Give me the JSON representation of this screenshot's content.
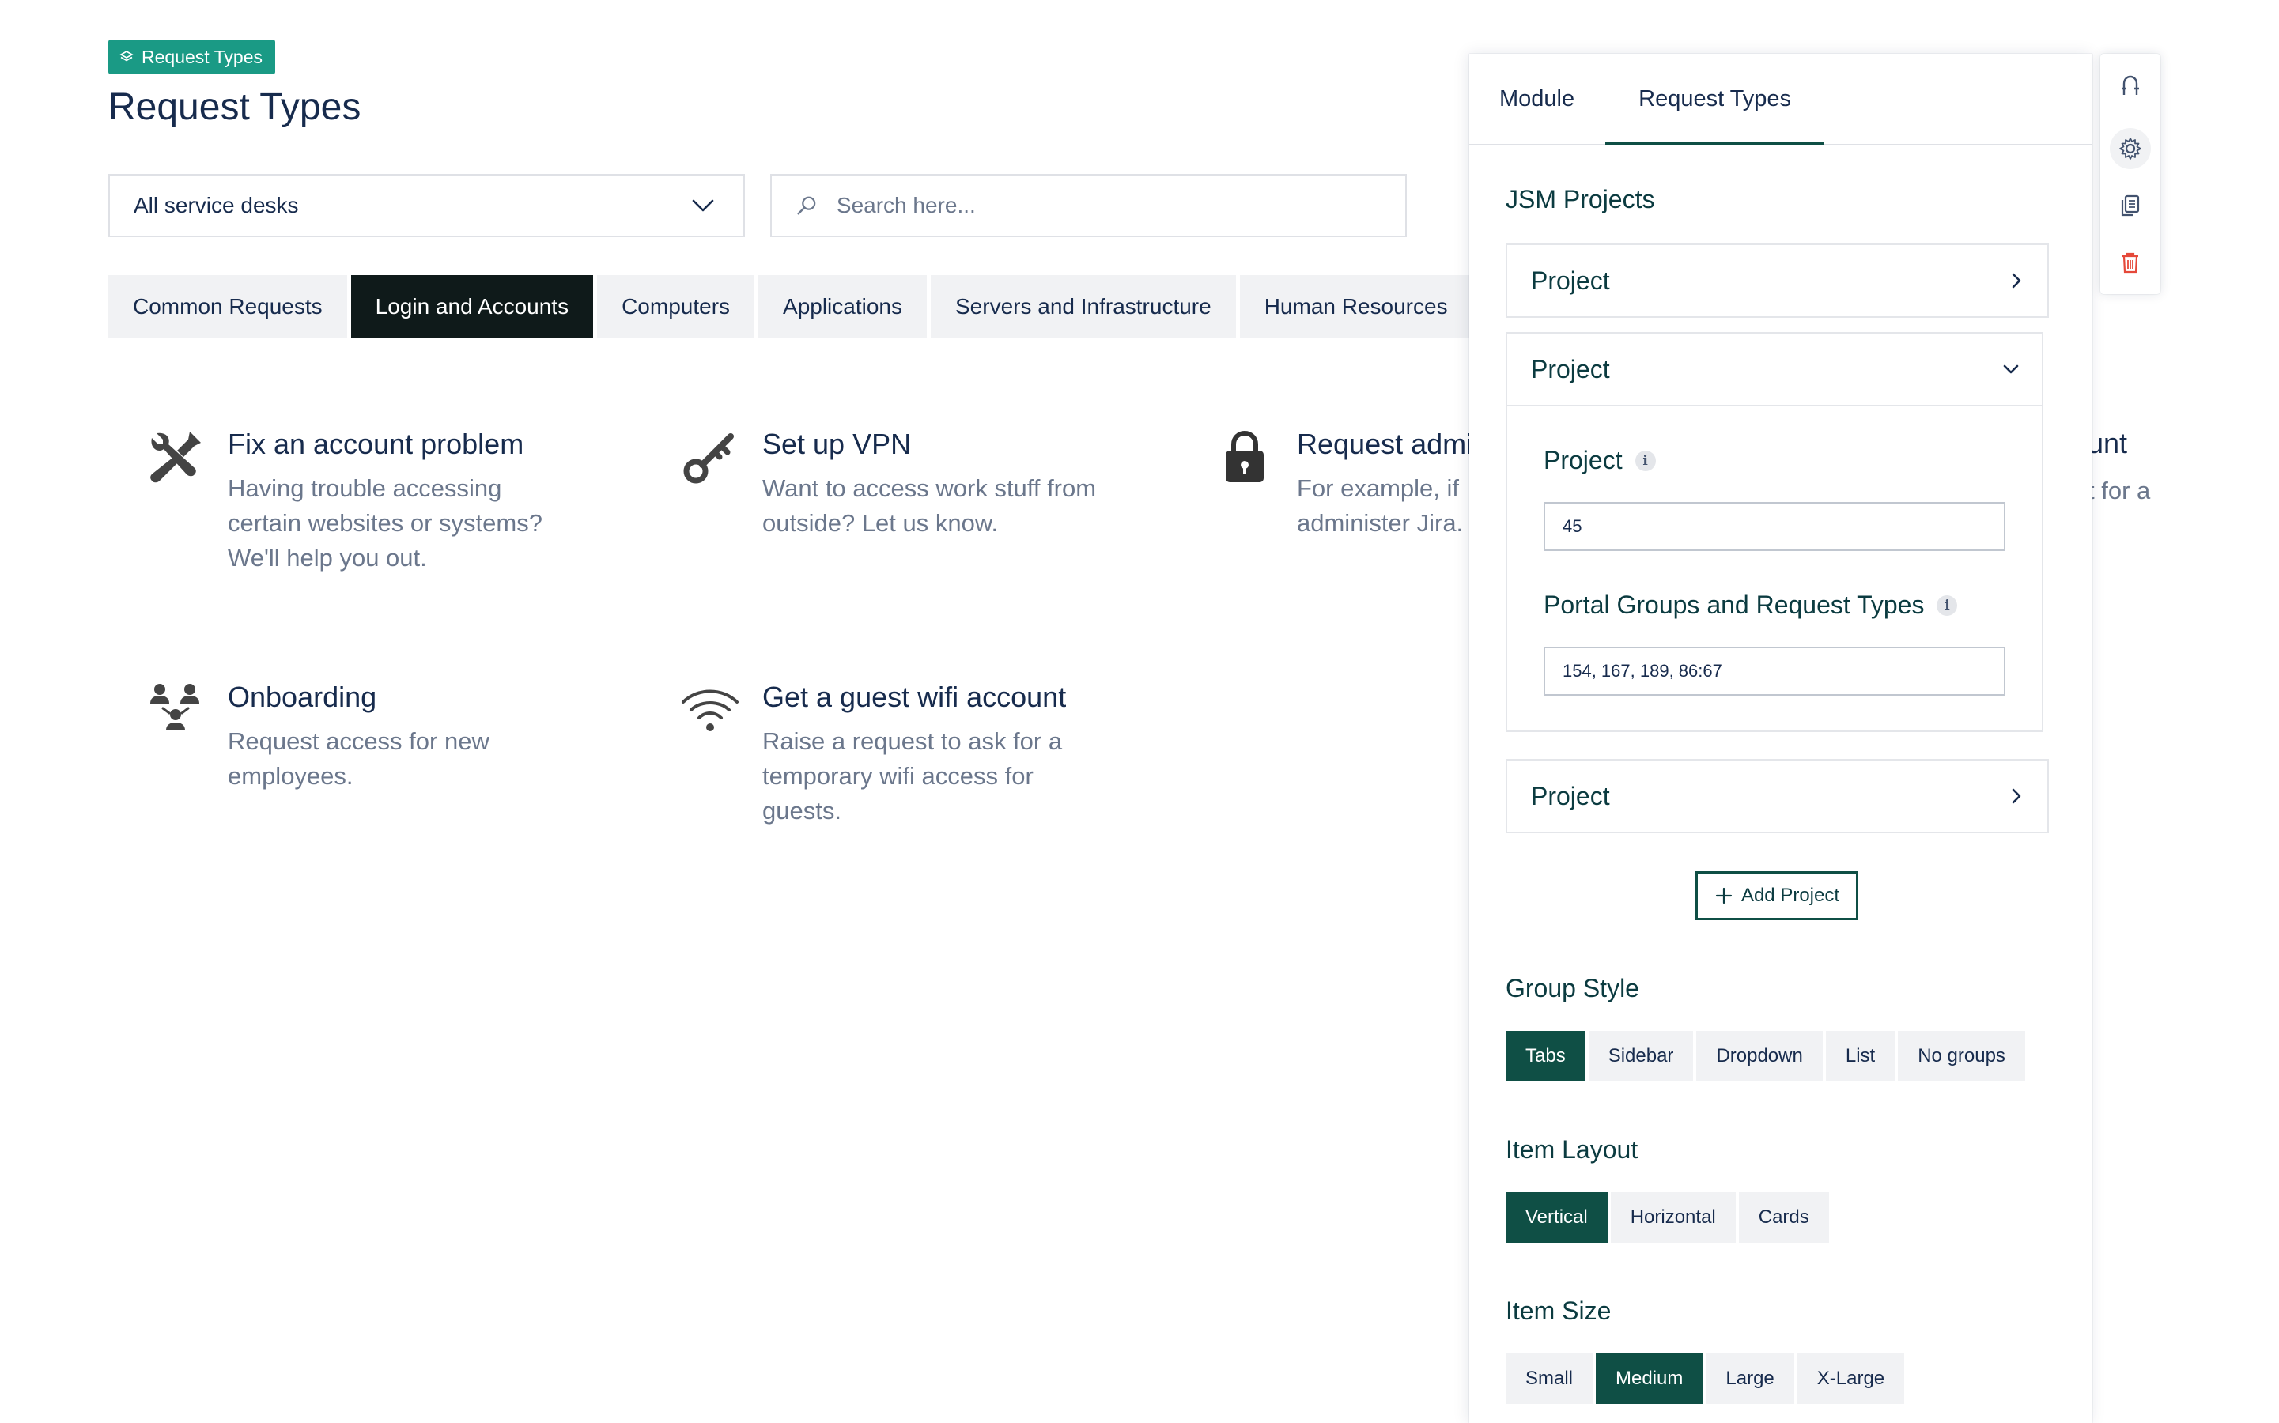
{
  "page": {
    "badge": "Request Types",
    "title": "Request Types",
    "service_desk_select": "All service desks",
    "search_placeholder": "Search here..."
  },
  "tabs": [
    {
      "label": "Common Requests",
      "active": false
    },
    {
      "label": "Login and Accounts",
      "active": true
    },
    {
      "label": "Computers",
      "active": false
    },
    {
      "label": "Applications",
      "active": false
    },
    {
      "label": "Servers and Infrastructure",
      "active": false
    },
    {
      "label": "Human Resources",
      "active": false
    }
  ],
  "items": [
    {
      "title": "Fix an account problem",
      "desc": [
        "Having trouble accessing",
        "certain websites or systems?",
        "We'll help you out."
      ],
      "icon": "tools-icon"
    },
    {
      "title": "Set up VPN",
      "desc": [
        "Want to access work stuff from",
        "outside? Let us know."
      ],
      "icon": "key-icon"
    },
    {
      "title": "Request admi",
      "desc": [
        "For example, if",
        "administer Jira."
      ],
      "icon": "lock-icon"
    },
    {
      "title": "Onboarding",
      "desc": [
        "Request access for new",
        "employees."
      ],
      "icon": "people-icon"
    },
    {
      "title": "Get a guest wifi account",
      "desc": [
        "Raise a request to ask for a",
        "temporary wifi access for",
        "guests."
      ],
      "icon": "wifi-icon"
    }
  ],
  "clipped": {
    "title": "unt",
    "desc": "t for a"
  },
  "panel": {
    "tabs": [
      {
        "label": "Module",
        "active": false
      },
      {
        "label": "Request Types",
        "active": true
      }
    ],
    "jsm_title": "JSM Projects",
    "projects": [
      {
        "header": "Project",
        "expanded": false
      },
      {
        "header": "Project",
        "expanded": true,
        "field_project_label": "Project",
        "field_project_value": "45",
        "field_groups_label": "Portal Groups and Request Types",
        "field_groups_value": "154, 167, 189, 86:67"
      },
      {
        "header": "Project",
        "expanded": false
      }
    ],
    "add_project_label": "Add Project",
    "group_style": {
      "title": "Group Style",
      "options": [
        "Tabs",
        "Sidebar",
        "Dropdown",
        "List",
        "No groups"
      ],
      "selected": "Tabs"
    },
    "item_layout": {
      "title": "Item Layout",
      "options": [
        "Vertical",
        "Horizontal",
        "Cards"
      ],
      "selected": "Vertical"
    },
    "item_size": {
      "title": "Item Size",
      "options": [
        "Small",
        "Medium",
        "Large",
        "X-Large"
      ],
      "selected": "Medium"
    }
  },
  "toolbar": {
    "icons": [
      "arch-icon",
      "gear-icon",
      "copy-icon",
      "trash-icon"
    ],
    "selected": "gear-icon",
    "colors": {
      "trash": "#e5493a",
      "accent": "#0f4f45",
      "badge": "#1a9a85"
    }
  }
}
